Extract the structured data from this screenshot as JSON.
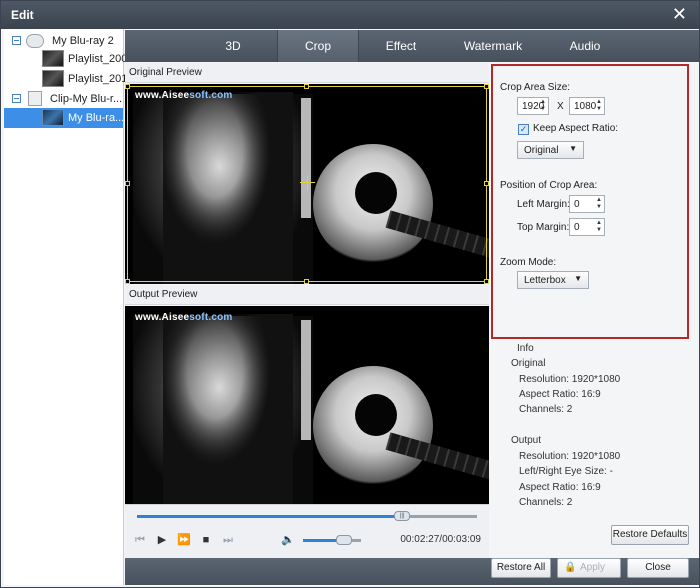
{
  "window": {
    "title": "Edit"
  },
  "tree": {
    "items": [
      {
        "label": "My Blu-ray 2"
      },
      {
        "label": "Playlist_200"
      },
      {
        "label": "Playlist_201"
      },
      {
        "label": "Clip-My Blu-r..."
      },
      {
        "label": "My Blu-ra..."
      }
    ]
  },
  "tabs": [
    "3D",
    "Crop",
    "Effect",
    "Watermark",
    "Audio"
  ],
  "active_tab": "Crop",
  "preview": {
    "original_label": "Original Preview",
    "output_label": "Output Preview",
    "watermark_prefix": "www.",
    "watermark_brand": "Aisee",
    "watermark_suffix": "soft.com"
  },
  "crop": {
    "area_size_label": "Crop Area Size:",
    "width": "1920",
    "x_sep": "X",
    "height": "1080",
    "keep_aspect_label": "Keep Aspect Ratio:",
    "keep_aspect_checked": true,
    "aspect_option": "Original",
    "position_label": "Position of Crop Area:",
    "left_margin_label": "Left Margin:",
    "left_margin": "0",
    "top_margin_label": "Top Margin:",
    "top_margin": "0",
    "zoom_label": "Zoom Mode:",
    "zoom_option": "Letterbox"
  },
  "info": {
    "heading": "Info",
    "original_heading": "Original",
    "original": {
      "resolution": "Resolution: 1920*1080",
      "aspect": "Aspect Ratio: 16:9",
      "channels": "Channels: 2"
    },
    "output_heading": "Output",
    "output": {
      "resolution": "Resolution: 1920*1080",
      "eye_size": "Left/Right Eye Size: -",
      "aspect": "Aspect Ratio: 16:9",
      "channels": "Channels: 2"
    }
  },
  "player": {
    "time": "00:02:27/00:03:09",
    "progress": 0.78,
    "volume": 0.7
  },
  "buttons": {
    "restore_defaults": "Restore Defaults",
    "restore_all": "Restore All",
    "apply": "Apply",
    "close": "Close"
  },
  "colors": {
    "accent": "#3d8ee6",
    "highlight_border": "#b52828",
    "crop_border": "#e0d23a"
  }
}
